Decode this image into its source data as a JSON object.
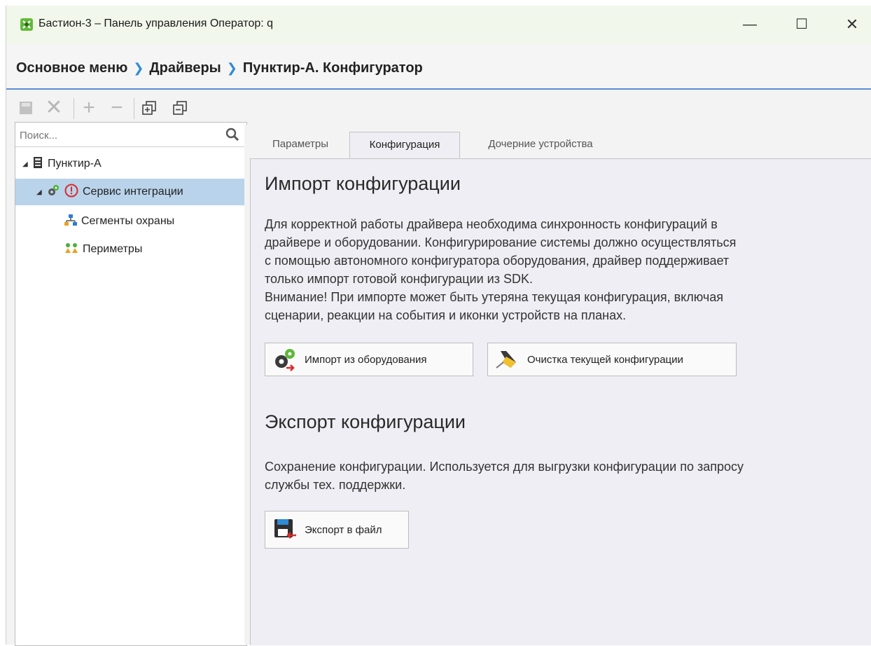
{
  "window": {
    "title": "Бастион-3 – Панель управления Оператор: q",
    "controls": {
      "minimize": "—",
      "maximize": "☐",
      "close": "✕"
    }
  },
  "breadcrumb": {
    "items": [
      "Основное меню",
      "Драйверы",
      "Пунктир-А. Конфигуратор"
    ],
    "separator": "❯"
  },
  "toolbar": {
    "save": "save-icon",
    "delete": "close-icon",
    "add": "plus-icon",
    "remove": "minus-icon",
    "expand": "expand-all-icon",
    "collapse": "collapse-all-icon"
  },
  "sidebar": {
    "search_placeholder": "Поиск...",
    "tree": [
      {
        "label": "Пунктир-А",
        "icon": "device-icon"
      },
      {
        "label": "Сервис интеграции",
        "icon": "service-icon",
        "status": "error",
        "selected": true
      },
      {
        "label": "Сегменты охраны",
        "icon": "segments-icon"
      },
      {
        "label": "Периметры",
        "icon": "perimeters-icon"
      }
    ]
  },
  "tabs": [
    {
      "label": "Параметры",
      "active": false
    },
    {
      "label": "Конфигурация",
      "active": true
    },
    {
      "label": "Дочерние устройства",
      "active": false
    }
  ],
  "import_section": {
    "heading": "Импорт конфигурации",
    "lines": [
      "Для корректной работы драйвера необходима синхронность конфигураций в",
      "драйвере и оборудовании. Конфигурирование системы должно осуществляться",
      "с помощью автономного конфигуратора оборудования, драйвер поддерживает",
      "только импорт готовой конфигурации из SDK.",
      "Внимание! При импорте может быть утеряна текущая конфигурация, включая",
      "сценарии, реакции на события и иконки устройств на планах."
    ],
    "import_button": "Импорт из оборудования",
    "clear_button": "Очистка текущей конфигурации"
  },
  "export_section": {
    "heading": "Экспорт конфигурации",
    "lines": [
      "Сохранение конфигурации. Используется для выгрузки конфигурации по запросу",
      "службы тех. поддержки."
    ],
    "export_button": "Экспорт в файл"
  },
  "colors": {
    "accent": "#2e8bd6",
    "selection": "#b9d3ea",
    "error": "#d92b2b",
    "title_bg": "#f1f7ea"
  }
}
